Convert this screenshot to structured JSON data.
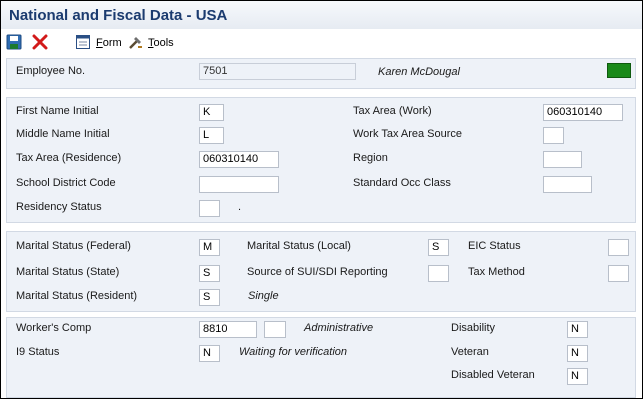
{
  "window": {
    "title": "National and Fiscal Data - USA"
  },
  "toolbar": {
    "save_icon": "save-icon",
    "close_icon": "close-x-icon",
    "form_label_first": "F",
    "form_label_rest": "orm",
    "tools_label_first": "T",
    "tools_label_rest": "ools"
  },
  "employee": {
    "label": "Employee No.",
    "number": "7501",
    "name": "Karen McDougal",
    "status_color": "#1a8a1a"
  },
  "personal": {
    "first_initial_label": "First Name Initial",
    "first_initial": "K",
    "middle_initial_label": "Middle Name Initial",
    "middle_initial": "L",
    "tax_area_res_label": "Tax Area (Residence)",
    "tax_area_res": "060310140",
    "school_district_label": "School District Code",
    "school_district": "",
    "residency_label": "Residency Status",
    "residency": "",
    "residency_desc": ".",
    "tax_area_work_label": "Tax Area (Work)",
    "tax_area_work": "060310140",
    "work_tax_source_label": "Work Tax Area Source",
    "work_tax_source": "",
    "region_label": "Region",
    "region": "",
    "occ_class_label": "Standard Occ Class",
    "occ_class": ""
  },
  "marital": {
    "federal_label": "Marital Status (Federal)",
    "federal": "M",
    "state_label": "Marital Status (State)",
    "state": "S",
    "resident_label": "Marital Status (Resident)",
    "resident": "S",
    "resident_desc": "Single",
    "local_label": "Marital Status (Local)",
    "local": "S",
    "sui_label": "Source of SUI/SDI Reporting",
    "sui": "",
    "eic_label": "EIC Status",
    "eic": "",
    "tax_method_label": "Tax Method",
    "tax_method": ""
  },
  "comp": {
    "workers_comp_label": "Worker's Comp",
    "workers_comp": "8810",
    "workers_comp_sub": "",
    "workers_comp_desc": "Administrative",
    "i9_label": "I9 Status",
    "i9": "N",
    "i9_desc": "Waiting for verification",
    "disability_label": "Disability",
    "disability": "N",
    "veteran_label": "Veteran",
    "veteran": "N",
    "disabled_veteran_label": "Disabled Veteran",
    "disabled_veteran": "N"
  }
}
